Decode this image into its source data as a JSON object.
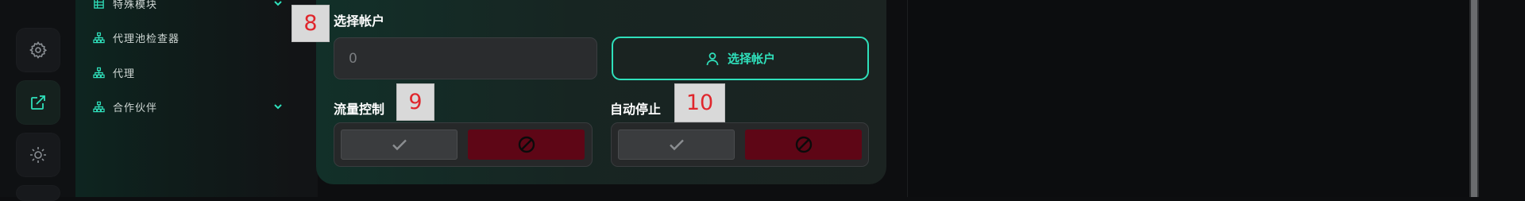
{
  "accent": "#2fe0bb",
  "icon_rail": [
    {
      "icon": "gear-icon"
    },
    {
      "icon": "external-link-icon",
      "active": true
    },
    {
      "icon": "sun-icon"
    }
  ],
  "sidebar": {
    "items": [
      {
        "label": "特殊模块",
        "icon": "table-icon",
        "has_chevron": true
      },
      {
        "label": "代理池检查器",
        "icon": "sitemap-icon",
        "has_chevron": false
      },
      {
        "label": "代理",
        "icon": "sitemap-icon",
        "has_chevron": false
      },
      {
        "label": "合作伙伴",
        "icon": "sitemap-icon",
        "has_chevron": true
      }
    ]
  },
  "form": {
    "select_account": {
      "label": "选择帐户",
      "badge": "8",
      "input_value": "0",
      "button_label": "选择帐户"
    },
    "traffic_control": {
      "label": "流量控制",
      "badge": "9"
    },
    "auto_stop": {
      "label": "自动停止",
      "badge": "10"
    }
  }
}
